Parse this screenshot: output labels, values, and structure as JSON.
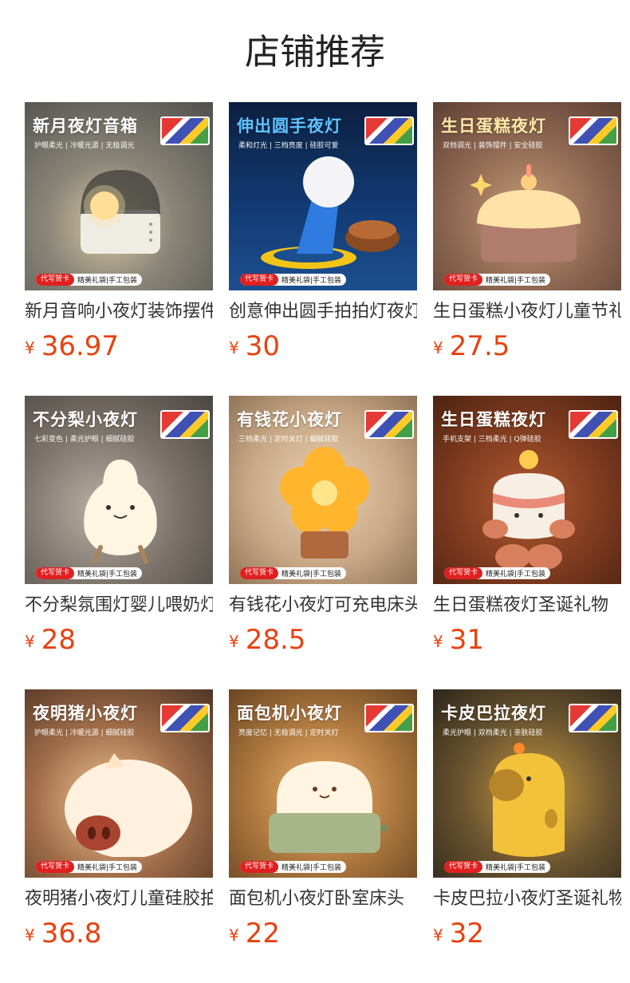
{
  "page": {
    "title": "店铺推荐"
  },
  "products": [
    {
      "headline": "新月夜灯音箱",
      "sub": "护眼柔光 | 冷暖光源 | 无极调光",
      "footer_tag": "代写贺卡",
      "footer_text": "精美礼袋|手工包装",
      "name": "新月音响小夜灯装饰摆件",
      "currency": "¥",
      "price": "36.97",
      "bg": "#6b6a66"
    },
    {
      "headline": "伸出圆手夜灯",
      "sub": "柔和灯光 | 三档亮度 | 硅胶可爱",
      "footer_tag": "代写贺卡",
      "footer_text": "精美礼袋|手工包装",
      "name": "创意伸出圆手拍拍灯夜灯",
      "currency": "¥",
      "price": "30",
      "bg": "#0b2f66"
    },
    {
      "headline": "生日蛋糕夜灯",
      "sub": "双档调光 | 装饰摆件 | 安全硅胶",
      "footer_tag": "代写贺卡",
      "footer_text": "精美礼袋|手工包装",
      "name": "生日蛋糕小夜灯儿童节礼物",
      "currency": "¥",
      "price": "27.5",
      "bg": "#8d6a57"
    },
    {
      "headline": "不分梨小夜灯",
      "sub": "七彩变色 | 柔光护眼 | 细腻硅胶",
      "footer_tag": "代写贺卡",
      "footer_text": "精美礼袋|手工包装",
      "name": "不分梨氛围灯婴儿喂奶灯",
      "currency": "¥",
      "price": "28",
      "bg": "#6f665c"
    },
    {
      "headline": "有钱花小夜灯",
      "sub": "三档柔光 | 定时关灯 | 细腻硅胶",
      "footer_tag": "代写贺卡",
      "footer_text": "精美礼袋|手工包装",
      "name": "有钱花小夜灯可充电床头灯",
      "currency": "¥",
      "price": "28.5",
      "bg": "#b99a7a"
    },
    {
      "headline": "生日蛋糕夜灯",
      "sub": "手机支架 | 三档柔光 | Q弹硅胶",
      "footer_tag": "代写贺卡",
      "footer_text": "精美礼袋|手工包装",
      "name": "生日蛋糕夜灯圣诞礼物",
      "currency": "¥",
      "price": "31",
      "bg": "#7a3a1e"
    },
    {
      "headline": "夜明猪小夜灯",
      "sub": "护眼柔光 | 冷暖光源 | 细腻硅胶",
      "footer_tag": "代写贺卡",
      "footer_text": "精美礼袋|手工包装",
      "name": "夜明猪小夜灯儿童硅胶拍拍灯",
      "currency": "¥",
      "price": "36.8",
      "bg": "#5a4032"
    },
    {
      "headline": "面包机小夜灯",
      "sub": "亮度记忆 | 无极调光 | 定时关灯",
      "footer_tag": "代写贺卡",
      "footer_text": "精美礼袋|手工包装",
      "name": "面包机小夜灯卧室床头",
      "currency": "¥",
      "price": "22",
      "bg": "#9a6a36"
    },
    {
      "headline": "卡皮巴拉夜灯",
      "sub": "柔光护眼 | 双档柔光 | 亲肤硅胶",
      "footer_tag": "代写贺卡",
      "footer_text": "精美礼袋|手工包装",
      "name": "卡皮巴拉小夜灯圣诞礼物",
      "currency": "¥",
      "price": "32",
      "bg": "#3e3424"
    }
  ]
}
